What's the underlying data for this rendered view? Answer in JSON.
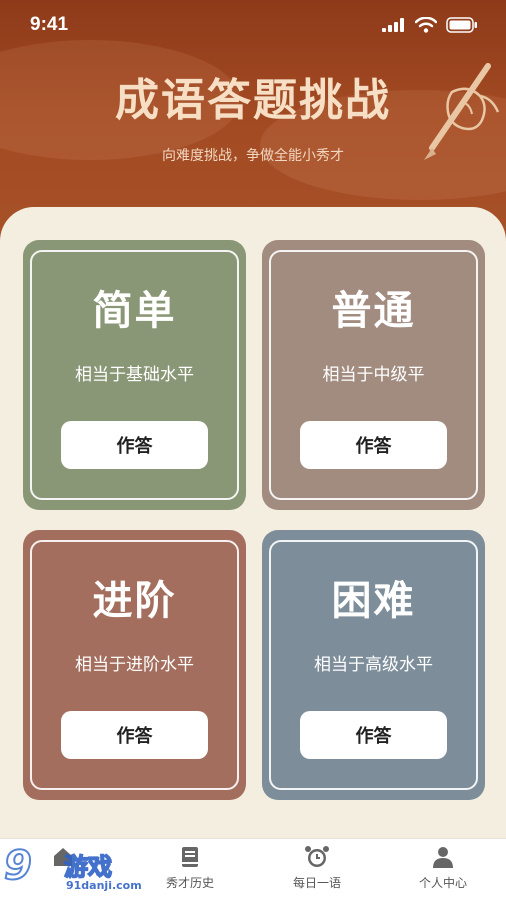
{
  "status_bar": {
    "time": "9:41"
  },
  "header": {
    "title": "成语答题挑战",
    "subtitle": "向难度挑战，争做全能小秀才",
    "colors": {
      "top": "#8e3a1a",
      "bottom": "#a8522a"
    }
  },
  "levels": [
    {
      "name": "简单",
      "description": "相当于基础水平",
      "button": "作答",
      "color": "#8a9777"
    },
    {
      "name": "普通",
      "description": "相当于中级平",
      "button": "作答",
      "color": "#a28c80"
    },
    {
      "name": "进阶",
      "description": "相当于进阶水平",
      "button": "作答",
      "color": "#a46e5e"
    },
    {
      "name": "困难",
      "description": "相当于高级水平",
      "button": "作答",
      "color": "#7d8e9a"
    }
  ],
  "tabbar": {
    "items": [
      {
        "label": "",
        "icon": "home-icon"
      },
      {
        "label": "秀才历史",
        "icon": "book-icon"
      },
      {
        "label": "每日一语",
        "icon": "alarm-clock-icon"
      },
      {
        "label": "个人中心",
        "icon": "person-icon"
      }
    ]
  },
  "watermark": {
    "number": "9",
    "text": "游戏",
    "domain": "91danji.com"
  }
}
